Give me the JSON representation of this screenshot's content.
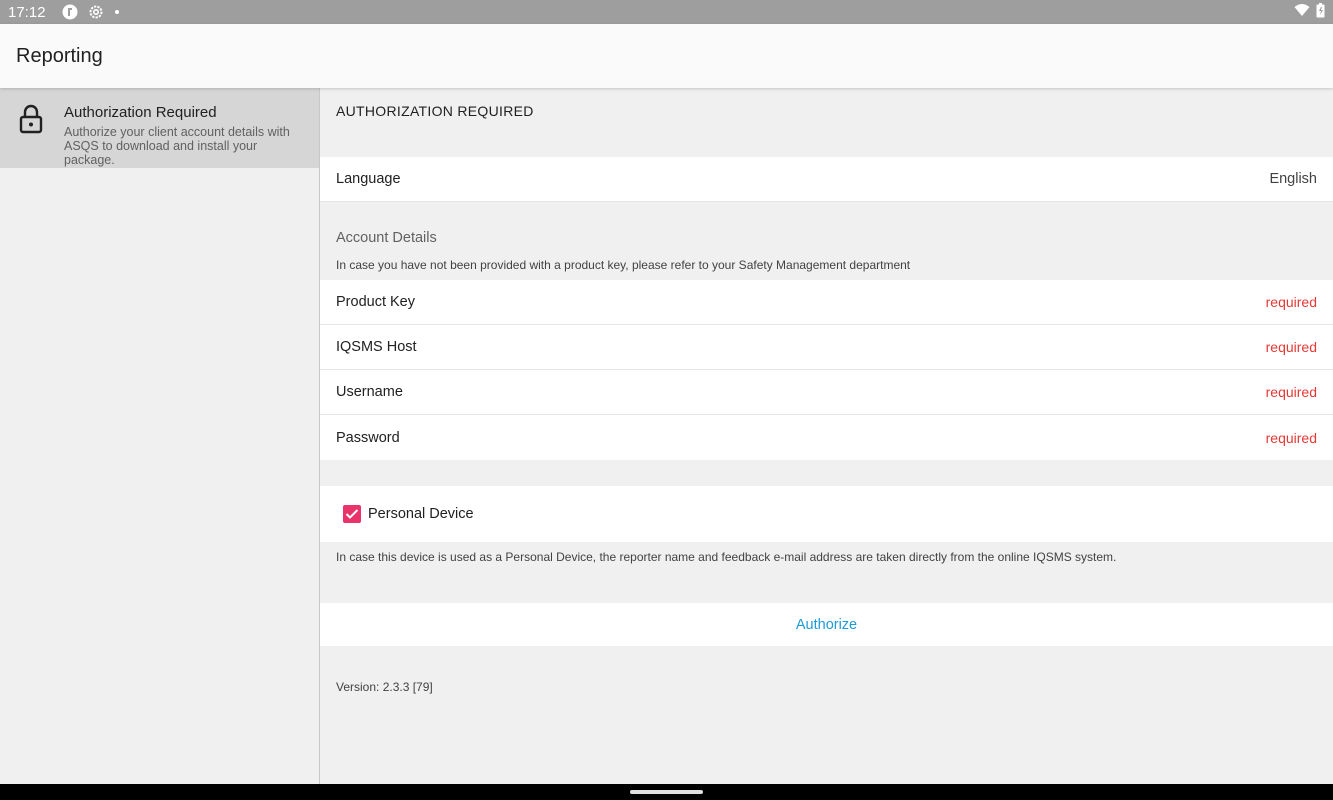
{
  "status_bar": {
    "time": "17:12"
  },
  "app_bar": {
    "title": "Reporting"
  },
  "sidebar": {
    "items": [
      {
        "title": "Authorization Required",
        "description": "Authorize your client account details with ASQS to download and install your package."
      }
    ]
  },
  "main": {
    "section_title": "AUTHORIZATION REQUIRED",
    "language": {
      "label": "Language",
      "value": "English"
    },
    "account_details": {
      "title": "Account Details",
      "description": "In case you have not been provided with a product key, please refer to your Safety Management department",
      "fields": [
        {
          "label": "Product Key",
          "status": "required"
        },
        {
          "label": "IQSMS Host",
          "status": "required"
        },
        {
          "label": "Username",
          "status": "required"
        },
        {
          "label": "Password",
          "status": "required"
        }
      ]
    },
    "personal_device": {
      "label": "Personal Device",
      "checked": true,
      "note": "In case this device is used as a Personal Device, the reporter name and feedback e-mail address are taken directly from the online IQSMS system."
    },
    "authorize_label": "Authorize",
    "version": "Version: 2.3.3 [79]"
  },
  "colors": {
    "required": "#e53935",
    "link": "#1e9bd7",
    "checkbox": "#e8336b"
  }
}
